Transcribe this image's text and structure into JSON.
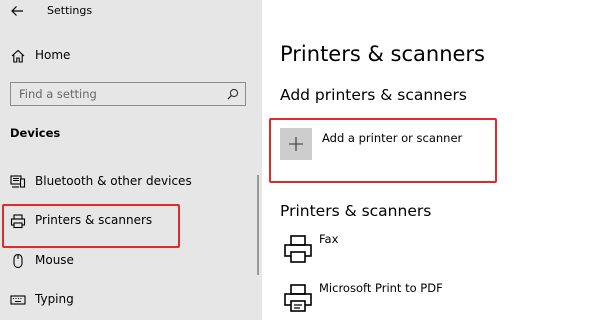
{
  "window": {
    "title": "Settings"
  },
  "sidebar": {
    "home_label": "Home",
    "search": {
      "placeholder": "Find a setting"
    },
    "section_heading": "Devices",
    "items": [
      {
        "label": "Bluetooth & other devices",
        "icon": "bluetooth-devices-icon"
      },
      {
        "label": "Printers & scanners",
        "icon": "printer-icon",
        "selected": true
      },
      {
        "label": "Mouse",
        "icon": "mouse-icon"
      },
      {
        "label": "Typing",
        "icon": "keyboard-icon"
      }
    ]
  },
  "main": {
    "page_title": "Printers & scanners",
    "add_section": {
      "heading": "Add printers & scanners",
      "button_label": "Add a printer or scanner",
      "button_icon": "plus-icon"
    },
    "list_section": {
      "heading": "Printers & scanners",
      "devices": [
        {
          "name": "Fax",
          "icon": "printer-icon"
        },
        {
          "name": "Microsoft Print to PDF",
          "icon": "printer-icon"
        }
      ]
    }
  },
  "colors": {
    "sidebar_bg": "#e6e6e6",
    "highlight": "#e02b2b",
    "add_button_bg": "#cccccc"
  }
}
